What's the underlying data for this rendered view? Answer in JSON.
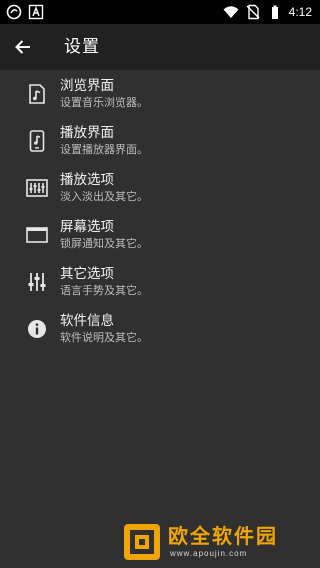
{
  "status_bar": {
    "time": "4:12",
    "icons": [
      "app-icon",
      "font-icon",
      "wifi-icon",
      "no-sim-icon",
      "battery-icon"
    ]
  },
  "app_bar": {
    "title": "设置",
    "back_icon": "arrow-left-icon"
  },
  "items": [
    {
      "title": "浏览界面",
      "subtitle": "设置音乐浏览器。",
      "icon": "music-file-icon"
    },
    {
      "title": "播放界面",
      "subtitle": "设置播放器界面。",
      "icon": "music-phone-icon"
    },
    {
      "title": "播放选项",
      "subtitle": "淡入淡出及其它。",
      "icon": "equalizer-panel-icon"
    },
    {
      "title": "屏幕选项",
      "subtitle": "锁屏通知及其它。",
      "icon": "screen-icon"
    },
    {
      "title": "其它选项",
      "subtitle": "语言手势及其它。",
      "icon": "sliders-icon"
    },
    {
      "title": "软件信息",
      "subtitle": "软件说明及其它。",
      "icon": "info-icon"
    }
  ],
  "watermark": {
    "name": "欧全软件园",
    "url": "www.apoujin.com"
  },
  "colors": {
    "background": "#303030",
    "app_bar": "#212121",
    "status_bar": "#000000",
    "text_primary": "#f2f2f2",
    "text_secondary": "#bdbdbd",
    "watermark": "#f0a500"
  }
}
